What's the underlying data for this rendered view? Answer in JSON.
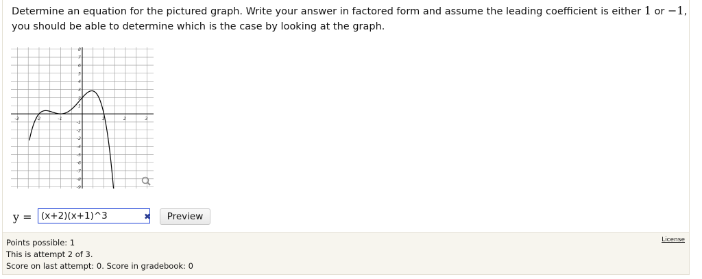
{
  "question": {
    "prefix": "Determine an equation for the pictured graph. Write your answer in factored form and assume the leading coefficient is either ",
    "coef_a": "1",
    "mid": " or ",
    "coef_b": "−1",
    "suffix": ",",
    "line2": "you should be able to determine which is the case by looking at the graph."
  },
  "graph": {
    "icon": "magnifier-icon",
    "x_ticks": [
      "-3",
      "-2",
      "-1",
      "1",
      "2",
      "3"
    ],
    "y_ticks_pos": [
      "8",
      "7",
      "6",
      "5",
      "4",
      "3",
      "2",
      "1"
    ],
    "y_ticks_neg": [
      "-1",
      "-2",
      "-3",
      "-4",
      "-5",
      "-6",
      "-7",
      "-8",
      "-9"
    ],
    "curve_color": "#000000",
    "grid_color": "#9a9a9a"
  },
  "answer": {
    "y_label": "y =",
    "value": "(x+2)(x+1)^3",
    "status_icon": "x-mark-icon",
    "preview_label": "Preview"
  },
  "footer": {
    "points": "Points possible: 1",
    "attempt": "This is attempt 2 of 3.",
    "score": "Score on last attempt: 0. Score in gradebook: 0",
    "license": "License"
  },
  "colors": {
    "input_border": "#1a3fd6",
    "footer_bg": "#f7f5ee",
    "status_icon": "#2a3b8f"
  }
}
